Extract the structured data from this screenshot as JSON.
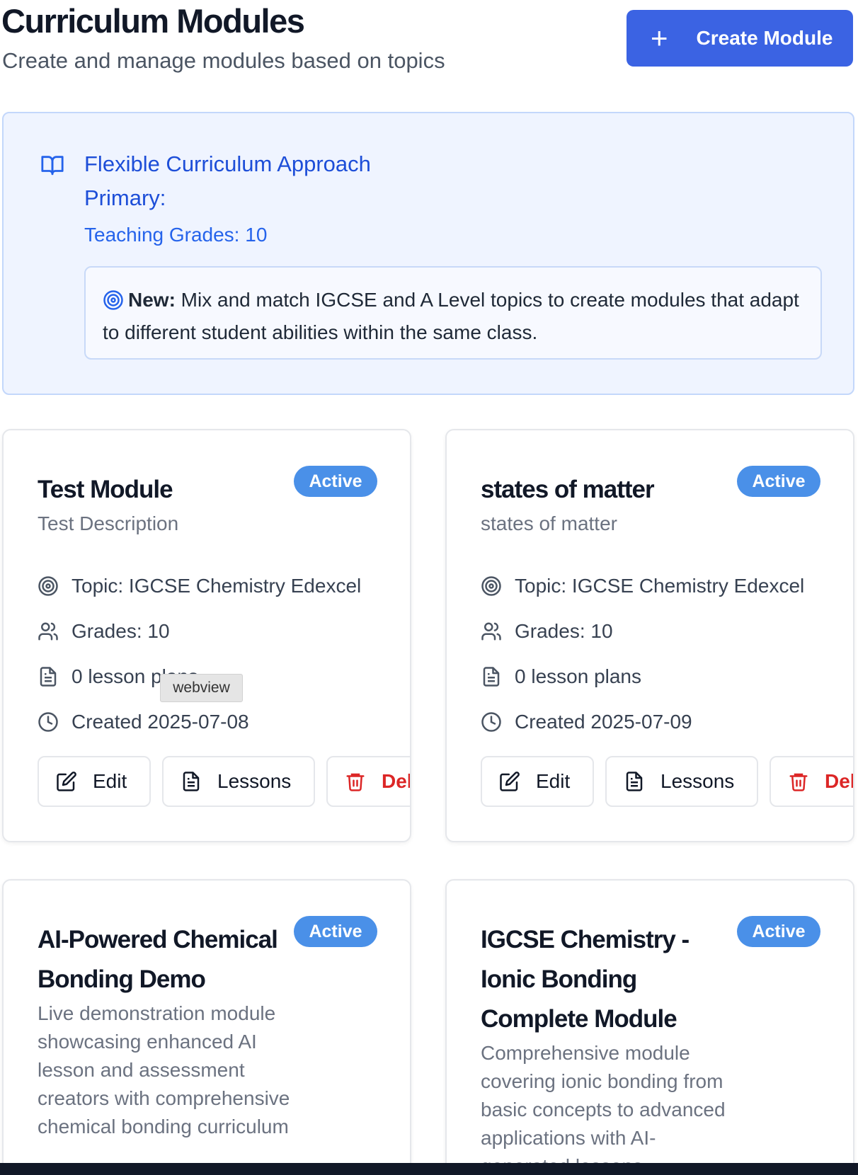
{
  "header": {
    "title": "Curriculum Modules",
    "subtitle": "Create and manage modules based on topics",
    "create_button": "Create Module"
  },
  "info_panel": {
    "heading": "Flexible Curriculum Approach",
    "primary": "Primary:",
    "teaching_grades": "Teaching Grades: 10",
    "note_bold": "New:",
    "note_text": " Mix and match IGCSE and A Level topics to create modules that adapt to different student abilities within the same class."
  },
  "modules": [
    {
      "title": "Test Module",
      "status": "Active",
      "description": "Test Description",
      "topic": "Topic: IGCSE Chemistry Edexcel",
      "grades": "Grades: 10",
      "lesson_plans": "0 lesson plans",
      "created": "Created 2025-07-08"
    },
    {
      "title": "states of matter",
      "status": "Active",
      "description": "states of matter",
      "topic": "Topic: IGCSE Chemistry Edexcel",
      "grades": "Grades: 10",
      "lesson_plans": "0 lesson plans",
      "created": "Created 2025-07-09"
    },
    {
      "title": "AI-Powered Chemical Bonding Demo",
      "status": "Active",
      "description": "Live demonstration module showcasing enhanced AI lesson and assessment creators with comprehensive chemical bonding curriculum"
    },
    {
      "title": "IGCSE Chemistry - Ionic Bonding Complete Module",
      "status": "Active",
      "description": "Comprehensive module covering ionic bonding from basic concepts to advanced applications with AI-generated lessons"
    }
  ],
  "card_actions": {
    "edit": "Edit",
    "lessons": "Lessons",
    "delete": "Delete"
  },
  "tooltip": "webview",
  "colors": {
    "primary": "#3b63e3",
    "badge": "#4a90e8",
    "danger": "#dc2626",
    "info_bg": "#eff4ff"
  },
  "icons": [
    "plus-icon",
    "book-open-icon",
    "target-icon",
    "users-icon",
    "file-text-icon",
    "clock-icon",
    "edit-icon",
    "trash-icon"
  ]
}
